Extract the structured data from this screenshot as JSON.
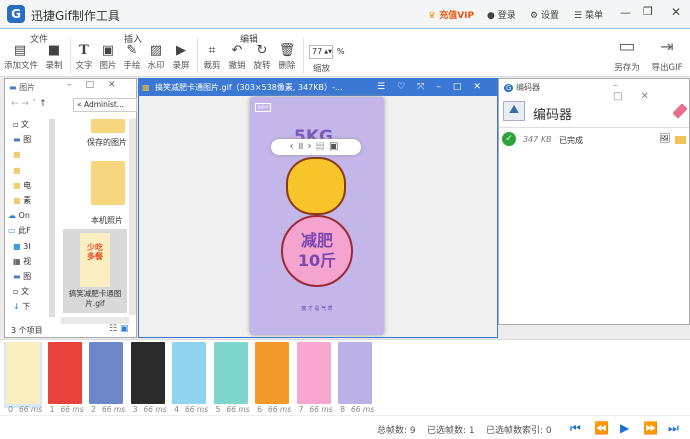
{
  "app": {
    "title": "迅捷Gif制作工具",
    "logo_letter": "G",
    "vip": "充值VIP",
    "login": "登录",
    "settings": "设置",
    "menu": "菜单"
  },
  "ribbon": {
    "groups": [
      "文件",
      "插入",
      "编辑"
    ],
    "buttons": [
      {
        "label": "添加文件",
        "icon": "add-file-icon"
      },
      {
        "label": "录制",
        "icon": "camera-icon"
      },
      {
        "label": "文字",
        "icon": "text-icon"
      },
      {
        "label": "图片",
        "icon": "image-icon"
      },
      {
        "label": "手绘",
        "icon": "pen-icon"
      },
      {
        "label": "水印",
        "icon": "watermark-icon"
      },
      {
        "label": "录屏",
        "icon": "screen-record-icon"
      },
      {
        "label": "裁剪",
        "icon": "crop-icon"
      },
      {
        "label": "撤销",
        "icon": "undo-icon"
      },
      {
        "label": "旋转",
        "icon": "rotate-icon"
      },
      {
        "label": "删除",
        "icon": "trash-icon"
      }
    ],
    "zoom_value": "77",
    "zoom_unit": "%",
    "zoom_label": "缩放",
    "save_as": "另存为",
    "export": "导出GIF"
  },
  "explorer": {
    "title": "图片",
    "path": "« Administ...",
    "nav_items": [
      "文",
      "图",
      "",
      "",
      "电",
      "素",
      "On",
      "此F",
      "3I",
      "视",
      "图",
      "文",
      "下"
    ],
    "files": [
      "保存的图片",
      "本机照片",
      "搞笑减肥卡通图片.gif"
    ],
    "status": "3 个项目"
  },
  "viewer": {
    "title": "搞笑减肥卡通图片.gif（303×538像素, 347KB）-...",
    "gif_text": {
      "top": "5KG",
      "main1": "减肥",
      "main2": "10斤",
      "sub": "瘦 才 是 气 质",
      "mark": "迅捷GIF"
    }
  },
  "encoder": {
    "title": "编码器",
    "heading": "编码器",
    "size": "347 KB",
    "state": "已完成"
  },
  "frames": [
    {
      "index": "0",
      "delay": "66 ms",
      "color": "#fbeec0"
    },
    {
      "index": "1",
      "delay": "66 ms",
      "color": "#e8403a"
    },
    {
      "index": "2",
      "delay": "66 ms",
      "color": "#6f86c8"
    },
    {
      "index": "3",
      "delay": "66 ms",
      "color": "#2b2b2b"
    },
    {
      "index": "4",
      "delay": "66 ms",
      "color": "#8fd3ef"
    },
    {
      "index": "5",
      "delay": "66 ms",
      "color": "#7ed6cc"
    },
    {
      "index": "6",
      "delay": "66 ms",
      "color": "#f39a2a"
    },
    {
      "index": "7",
      "delay": "66 ms",
      "color": "#f6a6cf"
    },
    {
      "index": "8",
      "delay": "66 ms",
      "color": "#bcb0e6"
    }
  ],
  "status": {
    "total": "总帧数: 9",
    "selected": "已选帧数: 1",
    "selected_index": "已选帧数索引: 0"
  }
}
